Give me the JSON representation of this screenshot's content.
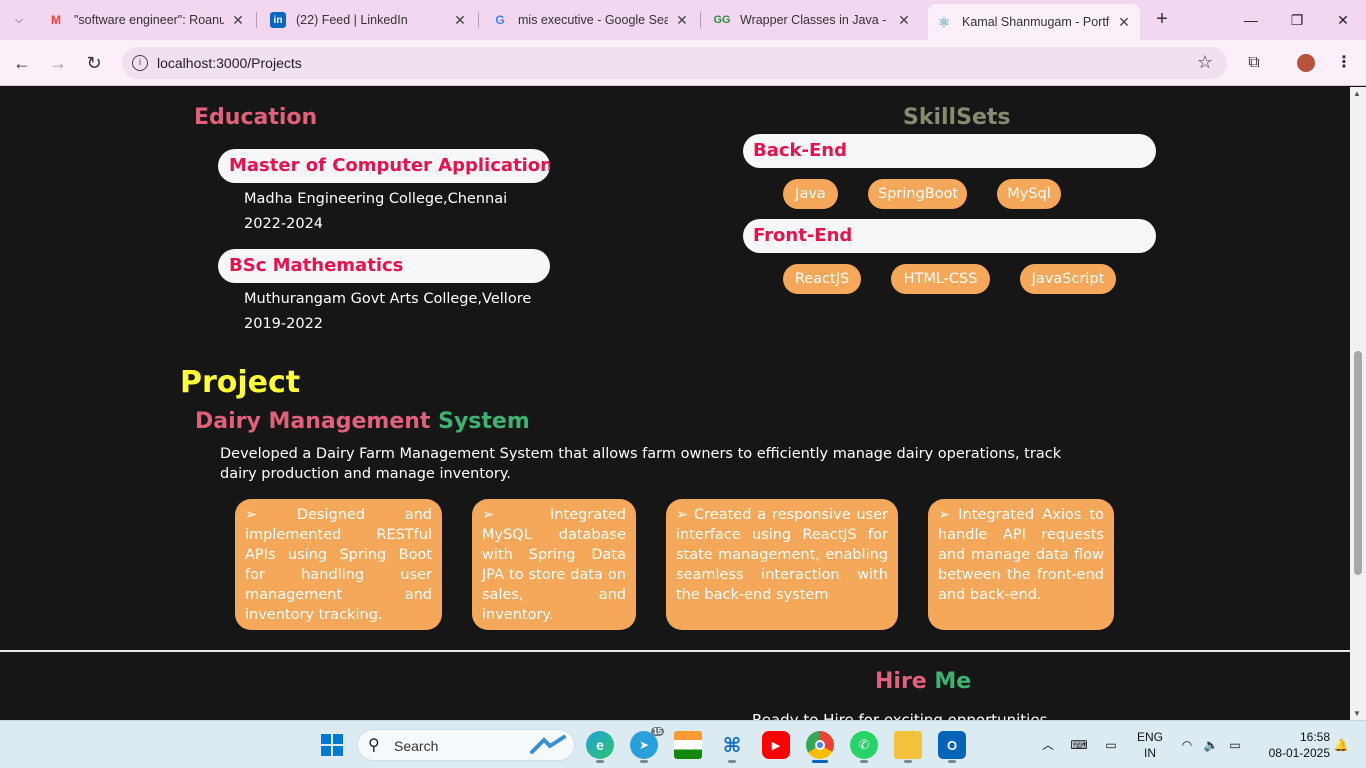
{
  "browser": {
    "tabs": [
      {
        "title": "\"software engineer\": Roanuz",
        "favicon": "gmail-icon"
      },
      {
        "title": "(22) Feed | LinkedIn",
        "favicon": "linkedin-icon"
      },
      {
        "title": "mis executive - Google Sear",
        "favicon": "google-icon"
      },
      {
        "title": "Wrapper Classes in Java - Ge",
        "favicon": "geeksforgeeks-icon"
      },
      {
        "title": "Kamal Shanmugam - Portfol",
        "favicon": "react-icon"
      }
    ],
    "url": "localhost:3000/Projects"
  },
  "education": {
    "heading": "Education",
    "entries": [
      {
        "degree": "Master of Computer Applications",
        "college": "Madha Engineering College,Chennai",
        "years": "2022-2024"
      },
      {
        "degree": "BSc Mathematics",
        "college": "Muthurangam Govt Arts College,Vellore",
        "years": "2019-2022"
      }
    ]
  },
  "skills": {
    "heading": "SkillSets",
    "groups": [
      {
        "title": "Back-End",
        "items": [
          "Java",
          "SpringBoot",
          "MySql"
        ]
      },
      {
        "title": "Front-End",
        "items": [
          "ReactJS",
          "HTML-CSS",
          "JavaScript"
        ]
      }
    ]
  },
  "project": {
    "heading": "Project",
    "name_part1": "Dairy Management",
    "name_part2": "System",
    "description": "Developed a Dairy Farm Management System that allows farm owners to efficiently manage dairy operations, track dairy production and manage inventory.",
    "bullets": [
      "➢ Designed and implemented RESTful APIs using Spring Boot for handling user management and inventory tracking.",
      "➢ Integrated MySQL database with Spring Data JPA to store data on sales, and inventory.",
      "➢ Created a responsive user interface using ReactJS for state management, enabling seamless interaction with the back-end system",
      "➢ Integrated Axios to handle API requests and manage data flow between the front-end and back-end."
    ]
  },
  "hire": {
    "heading_part1": "Hire",
    "heading_part2": "Me",
    "subtext": "Ready to Hire for exciting opportunities"
  },
  "taskbar": {
    "search_label": "Search",
    "telegram_badge": "15",
    "lang_line1": "ENG",
    "lang_line2": "IN",
    "time": "16:58",
    "date": "08-01-2025"
  },
  "colors": {
    "accent_pink": "#e8134e",
    "chip_orange": "#f5a75a",
    "project_yellow": "#ffff33",
    "title_rose": "#e2607a",
    "title_olive": "#8a8a70",
    "title_green": "#3cb371"
  }
}
